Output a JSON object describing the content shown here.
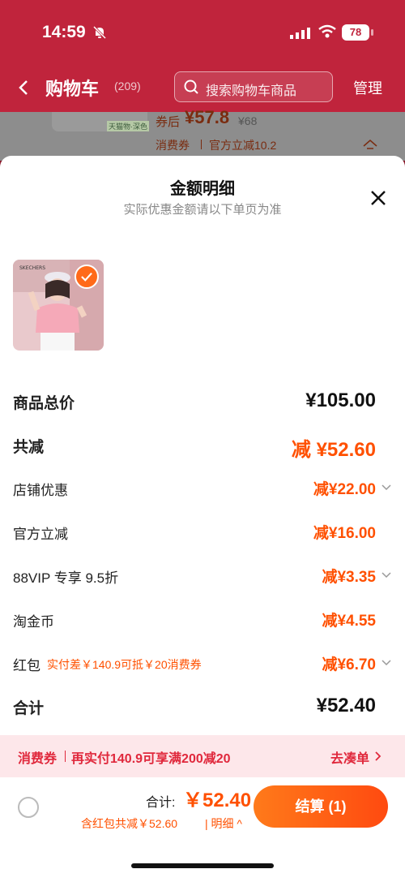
{
  "status": {
    "time": "14:59",
    "battery": "78"
  },
  "header": {
    "title": "购物车",
    "count": "(209)",
    "search_placeholder": "搜索购物车商品",
    "manage": "管理"
  },
  "background_product": {
    "tag": "天猫物·深色",
    "after_label": "券后",
    "price": "¥57.8",
    "orig_price": "¥68",
    "voucher": "消费券",
    "official": "官方立减10.2"
  },
  "sheet": {
    "title": "金额明细",
    "subtitle": "实际优惠金额请以下单页为准",
    "product_image_icon": "product-photo",
    "rows": {
      "total_price": {
        "label": "商品总价",
        "value": "¥105.00"
      },
      "total_reduce": {
        "label": "共减",
        "value": "减 ¥52.60"
      },
      "shop_discount": {
        "label": "店铺优惠",
        "value": "减¥22.00"
      },
      "official_discount": {
        "label": "官方立减",
        "value": "减¥16.00"
      },
      "vip_discount": {
        "label": "88VIP 专享 9.5折",
        "value": "减¥3.35"
      },
      "taojinbi": {
        "label": "淘金币",
        "value": "减¥4.55"
      },
      "red_packet": {
        "label": "红包",
        "note": "实付差￥140.9可抵￥20消费券",
        "value": "减¥6.70"
      },
      "subtotal": {
        "label": "合计",
        "value": "¥52.40"
      }
    }
  },
  "voucher_bar": {
    "label": "消费券",
    "text": "再实付140.9可享满200减20",
    "action": "去凑单"
  },
  "bottom_bar": {
    "total_label": "合计:",
    "total_value": "￥52.40",
    "note": "含红包共减￥52.60",
    "detail_link": "明细",
    "checkout": "结算 (1)"
  },
  "colors": {
    "accent": "#ff5000",
    "header": "#c0243c",
    "voucher_text": "#e0283c"
  }
}
